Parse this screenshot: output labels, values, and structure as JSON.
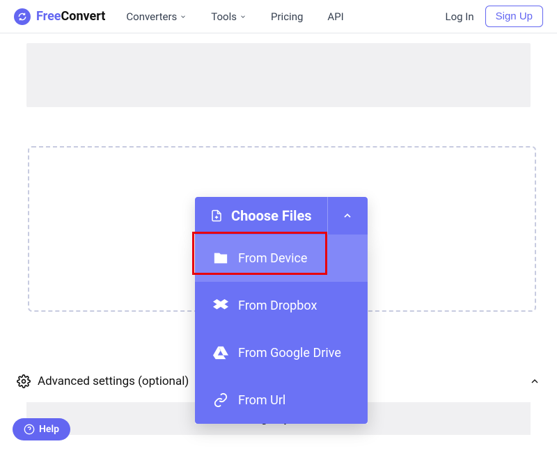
{
  "header": {
    "logo_part1": "Free",
    "logo_part2": "Convert",
    "nav": {
      "converters": "Converters",
      "tools": "Tools",
      "pricing": "Pricing",
      "api": "API"
    },
    "login": "Log In",
    "signup": "Sign Up"
  },
  "uploader": {
    "choose_files": "Choose Files",
    "sources": {
      "device": "From Device",
      "dropbox": "From Dropbox",
      "gdrive": "From Google Drive",
      "url": "From Url"
    }
  },
  "advanced": "Advanced settings (optional)",
  "help": "Help",
  "image_options": "Image Options"
}
